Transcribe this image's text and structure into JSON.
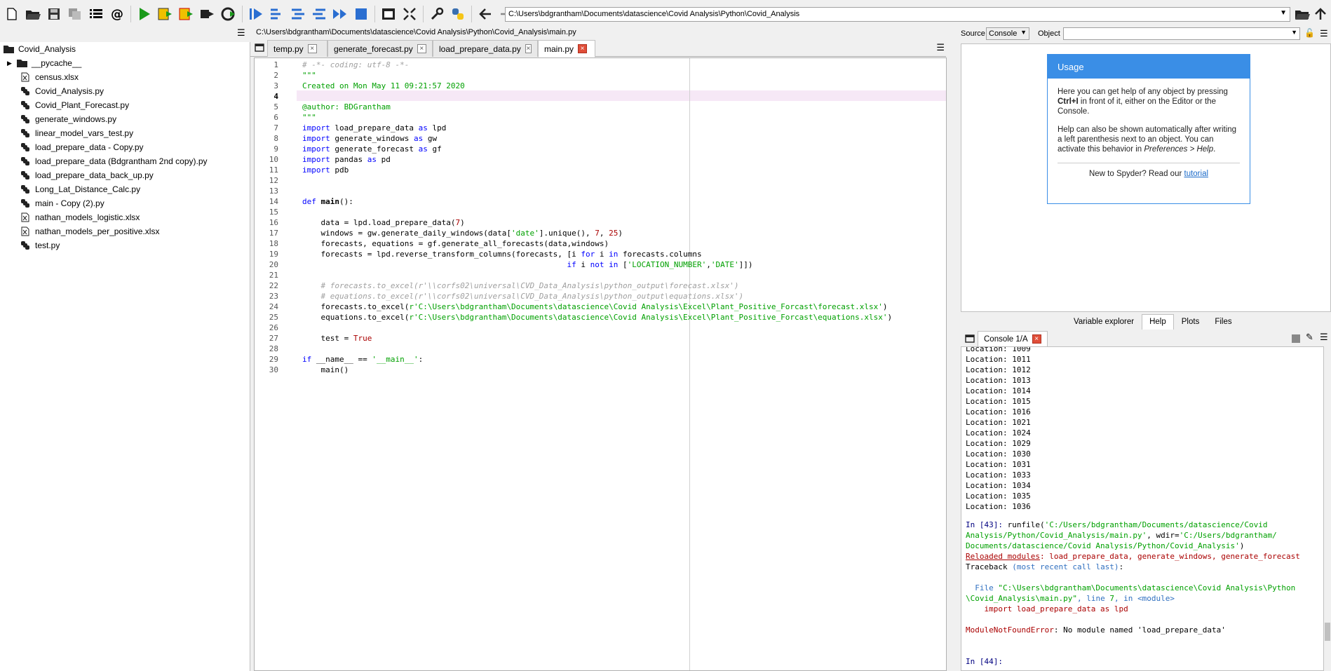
{
  "toolbar": {
    "path": "C:\\Users\\bdgrantham\\Documents\\datascience\\Covid Analysis\\Python\\Covid_Analysis"
  },
  "editor": {
    "file_path": "C:\\Users\\bdgrantham\\Documents\\datascience\\Covid Analysis\\Python\\Covid_Analysis\\main.py",
    "tabs": [
      {
        "label": "temp.py"
      },
      {
        "label": "generate_forecast.py"
      },
      {
        "label": "load_prepare_data.py"
      },
      {
        "label": "main.py"
      }
    ],
    "line_numbers": [
      "1",
      "2",
      "3",
      "4",
      "5",
      "6",
      "7",
      "8",
      "9",
      "10",
      "11",
      "12",
      "13",
      "14",
      "15",
      "16",
      "17",
      "18",
      "19",
      "20",
      "21",
      "22",
      "23",
      "24",
      "25",
      "26",
      "27",
      "28",
      "29",
      "30"
    ],
    "code": {
      "l1": "# -*- coding: utf-8 -*-",
      "l2": "\"\"\"",
      "l3": "Created on Mon May 11 09:21:57 2020",
      "l5": "@author: BDGrantham",
      "l6": "\"\"\"",
      "kw_import": "import",
      "kw_as": "as",
      "l7_mod": "load_prepare_data",
      "l7_alias": "lpd",
      "l8_mod": "generate_windows",
      "l8_alias": "gw",
      "l9_mod": "generate_forecast",
      "l9_alias": "gf",
      "l10_mod": "pandas",
      "l10_alias": "pd",
      "l11_mod": "pdb",
      "kw_def": "def",
      "l14_fn": "main",
      "l14_rest": "():",
      "l16": "    data = lpd.load_prepare_data(",
      "l16_num": "7",
      "l16_end": ")",
      "l17_a": "    windows = gw.generate_daily_windows(data[",
      "l17_str": "'date'",
      "l17_b": "].unique(), ",
      "l17_n1": "7",
      "l17_c": ", ",
      "l17_n2": "25",
      "l17_d": ")",
      "l18": "    forecasts, equations = gf.generate_all_forecasts(data,windows)",
      "l19_a": "    forecasts = lpd.reverse_transform_columns(forecasts, [i ",
      "kw_for": "for",
      "l19_b": " i ",
      "kw_in": "in",
      "l19_c": " forecasts.columns",
      "l20_pad": "                                                         ",
      "kw_if": "if",
      "l20_a": " i ",
      "kw_not": "not",
      "l20_b": " [",
      "l20_s1": "'LOCATION_NUMBER'",
      "l20_c": ",",
      "l20_s2": "'DATE'",
      "l20_d": "]])",
      "l22": "    # forecasts.to_excel(r'\\\\corfs02\\universal\\CVD_Data_Analysis\\python_output\\forecast.xlsx')",
      "l23": "    # equations.to_excel(r'\\\\corfs02\\universal\\CVD_Data_Analysis\\python_output\\equations.xlsx')",
      "l24_a": "    forecasts.to_excel(",
      "l24_s": "r'C:\\Users\\bdgrantham\\Documents\\datascience\\Covid Analysis\\Excel\\Plant_Positive_Forcast\\forecast.xlsx'",
      "l24_b": ")",
      "l25_a": "    equations.to_excel(",
      "l25_s": "r'C:\\Users\\bdgrantham\\Documents\\datascience\\Covid Analysis\\Excel\\Plant_Positive_Forcast\\equations.xlsx'",
      "l25_b": ")",
      "l27_a": "    test = ",
      "l27_b": "True",
      "l29_a": " __name__ == ",
      "l29_s": "'__main__'",
      "l29_b": ":",
      "l30": "    main()"
    }
  },
  "files": {
    "root": "Covid_Analysis",
    "items": [
      {
        "label": "__pycache__",
        "type": "folder"
      },
      {
        "label": "census.xlsx",
        "type": "xlsx"
      },
      {
        "label": "Covid_Analysis.py",
        "type": "py"
      },
      {
        "label": "Covid_Plant_Forecast.py",
        "type": "py"
      },
      {
        "label": "generate_windows.py",
        "type": "py"
      },
      {
        "label": "linear_model_vars_test.py",
        "type": "py"
      },
      {
        "label": "load_prepare_data - Copy.py",
        "type": "py"
      },
      {
        "label": "load_prepare_data (Bdgrantham 2nd copy).py",
        "type": "py"
      },
      {
        "label": "load_prepare_data_back_up.py",
        "type": "py"
      },
      {
        "label": "Long_Lat_Distance_Calc.py",
        "type": "py"
      },
      {
        "label": "main - Copy (2).py",
        "type": "py"
      },
      {
        "label": "nathan_models_logistic.xlsx",
        "type": "xlsx"
      },
      {
        "label": "nathan_models_per_positive.xlsx",
        "type": "xlsx"
      },
      {
        "label": "test.py",
        "type": "py"
      }
    ]
  },
  "help": {
    "source_label": "Source",
    "source_value": "Console",
    "object_label": "Object",
    "usage_title": "Usage",
    "p1_a": "Here you can get help of any object by pressing ",
    "p1_b": "Ctrl+I",
    "p1_c": " in front of it, either on the Editor or the Console.",
    "p2_a": "Help can also be shown automatically after writing a left parenthesis next to an object. You can activate this behavior in ",
    "p2_b": "Preferences > Help",
    "p2_c": ".",
    "new_a": "New to Spyder? Read our ",
    "new_link": "tutorial",
    "tabs": [
      {
        "label": "Variable explorer"
      },
      {
        "label": "Help"
      },
      {
        "label": "Plots"
      },
      {
        "label": "Files"
      }
    ]
  },
  "console": {
    "tab_label": "Console 1/A",
    "top_partial": "Location: 1009",
    "locations": [
      "Location: 1011",
      "Location: 1012",
      "Location: 1013",
      "Location: 1014",
      "Location: 1015",
      "Location: 1016",
      "Location: 1021",
      "Location: 1024",
      "Location: 1029",
      "Location: 1030",
      "Location: 1031",
      "Location: 1033",
      "Location: 1034",
      "Location: 1035",
      "Location: 1036"
    ],
    "in43_prompt": "In [43]:",
    "in43_a": " runfile(",
    "in43_s1": "'C:/Users/bdgrantham/Documents/datascience/Covid",
    "in43_s1b": "Analysis/Python/Covid_Analysis/main.py'",
    "in43_b": ", wdir=",
    "in43_s2": "'C:/Users/bdgrantham/",
    "in43_s2b": "Documents/datascience/Covid Analysis/Python/Covid_Analysis'",
    "in43_c": ")",
    "reloaded_label": "Reloaded modules",
    "reloaded_rest": ": load_prepare_data, generate_windows, generate_forecast",
    "traceback_a": "Traceback ",
    "traceback_b": "(most recent call last)",
    "traceback_c": ":",
    "file_a": "  File ",
    "file_path1": "\"C:\\Users\\bdgrantham\\Documents\\datascience\\Covid Analysis\\Python",
    "file_path2": "\\Covid_Analysis\\main.py\"",
    "file_b": ", line ",
    "file_line": "7",
    "file_c": ", in ",
    "file_mod": "<module>",
    "import_line": "    import load_prepare_data as lpd",
    "err_type": "ModuleNotFoundError",
    "err_msg": ": No module named 'load_prepare_data'",
    "in44_prompt": "In [44]:"
  }
}
